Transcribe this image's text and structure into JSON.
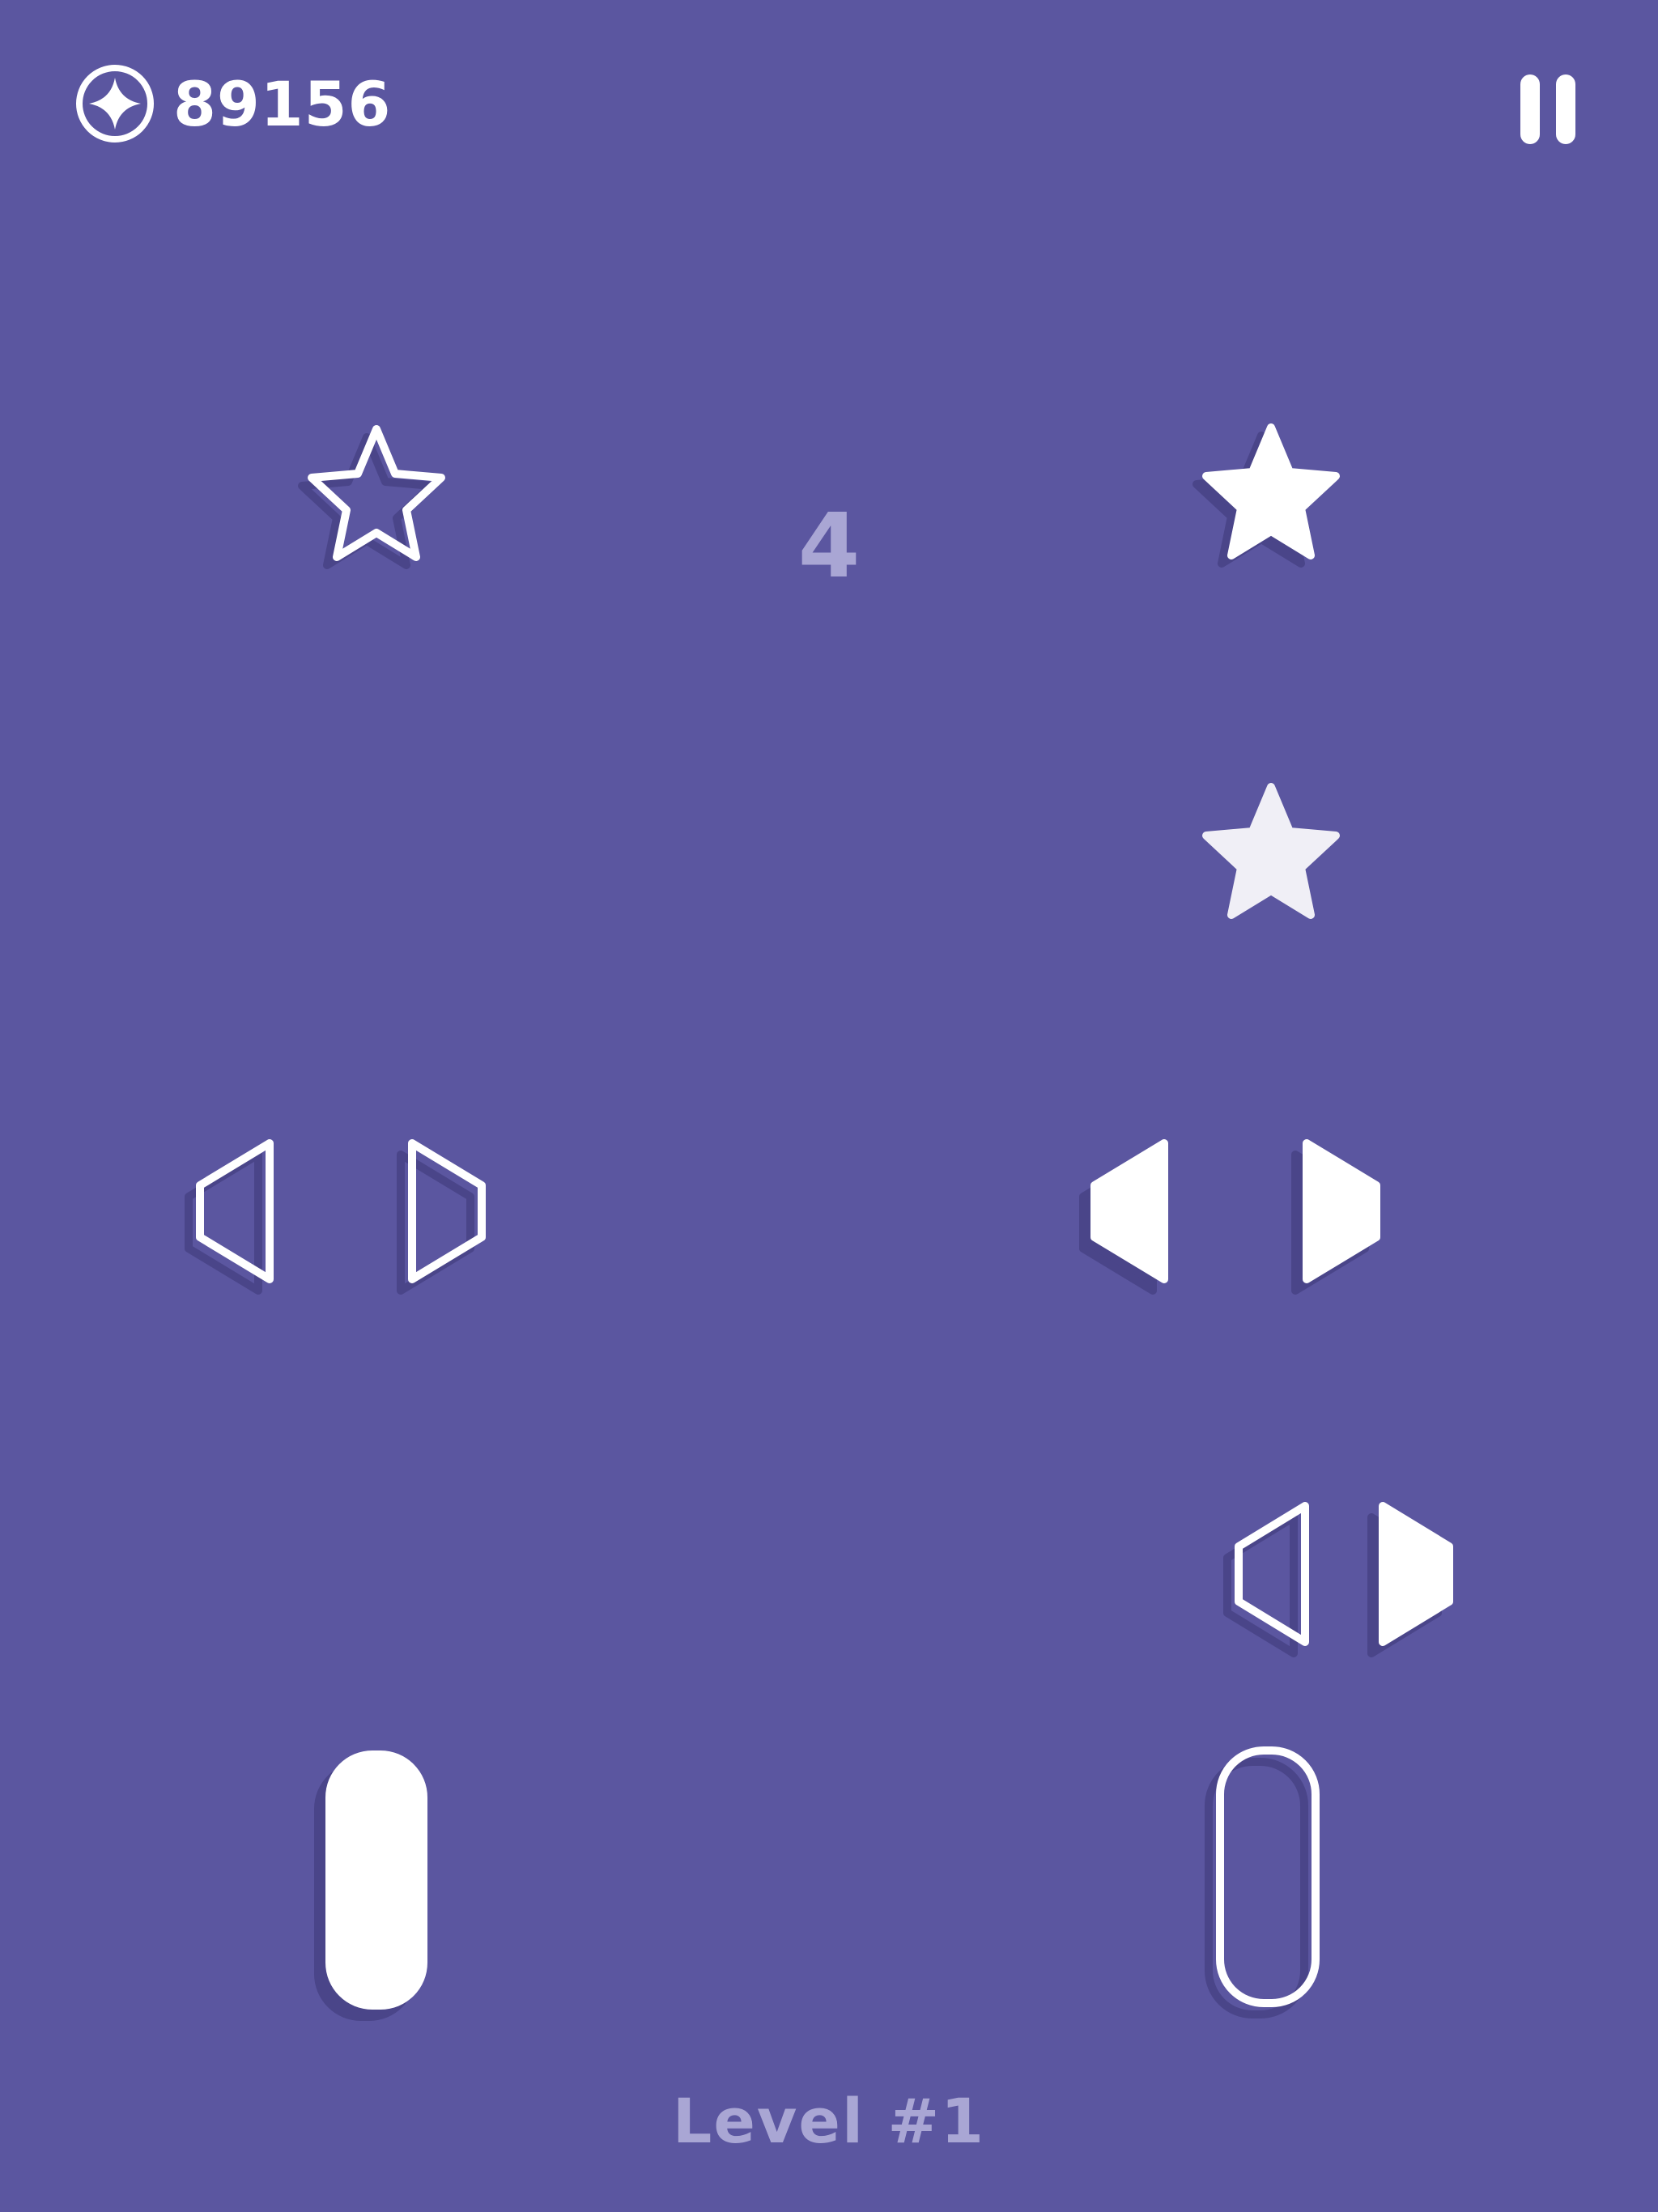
{
  "hud": {
    "score_icon": "star-coin-icon",
    "score": "89156",
    "pause_icon": "pause-icon"
  },
  "countdown": "4",
  "level_label": "Level #1",
  "colors": {
    "background": "#5b56a0",
    "shape": "#ffffff",
    "shadow": "#4a4589",
    "muted_text": "#a9a6d4"
  },
  "board": {
    "left_column": [
      {
        "shape": "star",
        "style": "outline"
      },
      {
        "shape": "split-hexagon",
        "style": "outline"
      },
      {
        "shape": "pill",
        "style": "filled"
      }
    ],
    "right_column": [
      {
        "shape": "star",
        "style": "filled"
      },
      {
        "shape": "star",
        "style": "filled-ghost"
      },
      {
        "shape": "split-hexagon",
        "style": "filled"
      },
      {
        "shape": "split-hexagon",
        "style": "half-outline-half-filled"
      },
      {
        "shape": "pill",
        "style": "outline"
      }
    ]
  }
}
